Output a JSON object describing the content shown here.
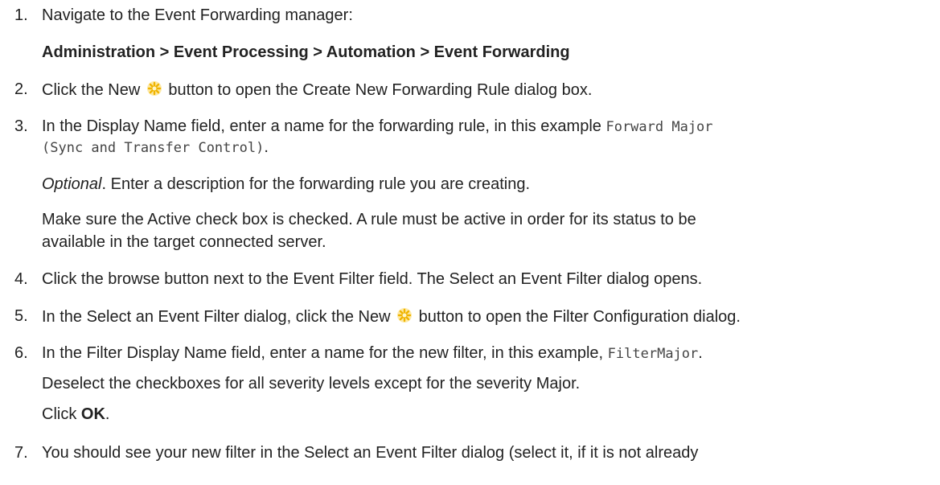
{
  "steps": [
    {
      "number": "1.",
      "lines": [
        "Navigate to the Event Forwarding manager:"
      ],
      "path": "Administration > Event Processing > Automation > Event Forwarding"
    },
    {
      "number": "2.",
      "before": "Click the New",
      "after": "button to open the Create New Forwarding Rule dialog box."
    },
    {
      "number": "3.",
      "line1_text": "In the Display Name field, enter a name for the forwarding rule, in this example",
      "line1_code": "Forward Major",
      "line2_code": "(Sync and Transfer Control)",
      "line2_tail": ".",
      "optional_label": "Optional",
      "optional_text": ". Enter a description for the forwarding rule you are creating.",
      "active_line1": "Make sure the Active check box is checked. A rule must be active in order for its status to be",
      "active_line2": "available in the target connected server."
    },
    {
      "number": "4.",
      "text": "Click the browse button next to the Event Filter field. The Select an Event Filter dialog opens."
    },
    {
      "number": "5.",
      "before": "In the Select an Event Filter dialog, click the New",
      "after": "button to open the Filter Configuration dialog."
    },
    {
      "number": "6.",
      "line1_text": "In the Filter Display Name field, enter a name for the new filter, in this example,",
      "line1_code": "FilterMajor",
      "line1_tail": ".",
      "line2": "Deselect the checkboxes for all severity levels except for the severity Major.",
      "click_prefix": "Click",
      "click_ok": "OK",
      "click_tail": "."
    },
    {
      "number": "7.",
      "text": "You should see your new filter in the Select an Event Filter dialog (select it, if it is not already"
    }
  ],
  "icons": {
    "new": "new-star-icon"
  }
}
